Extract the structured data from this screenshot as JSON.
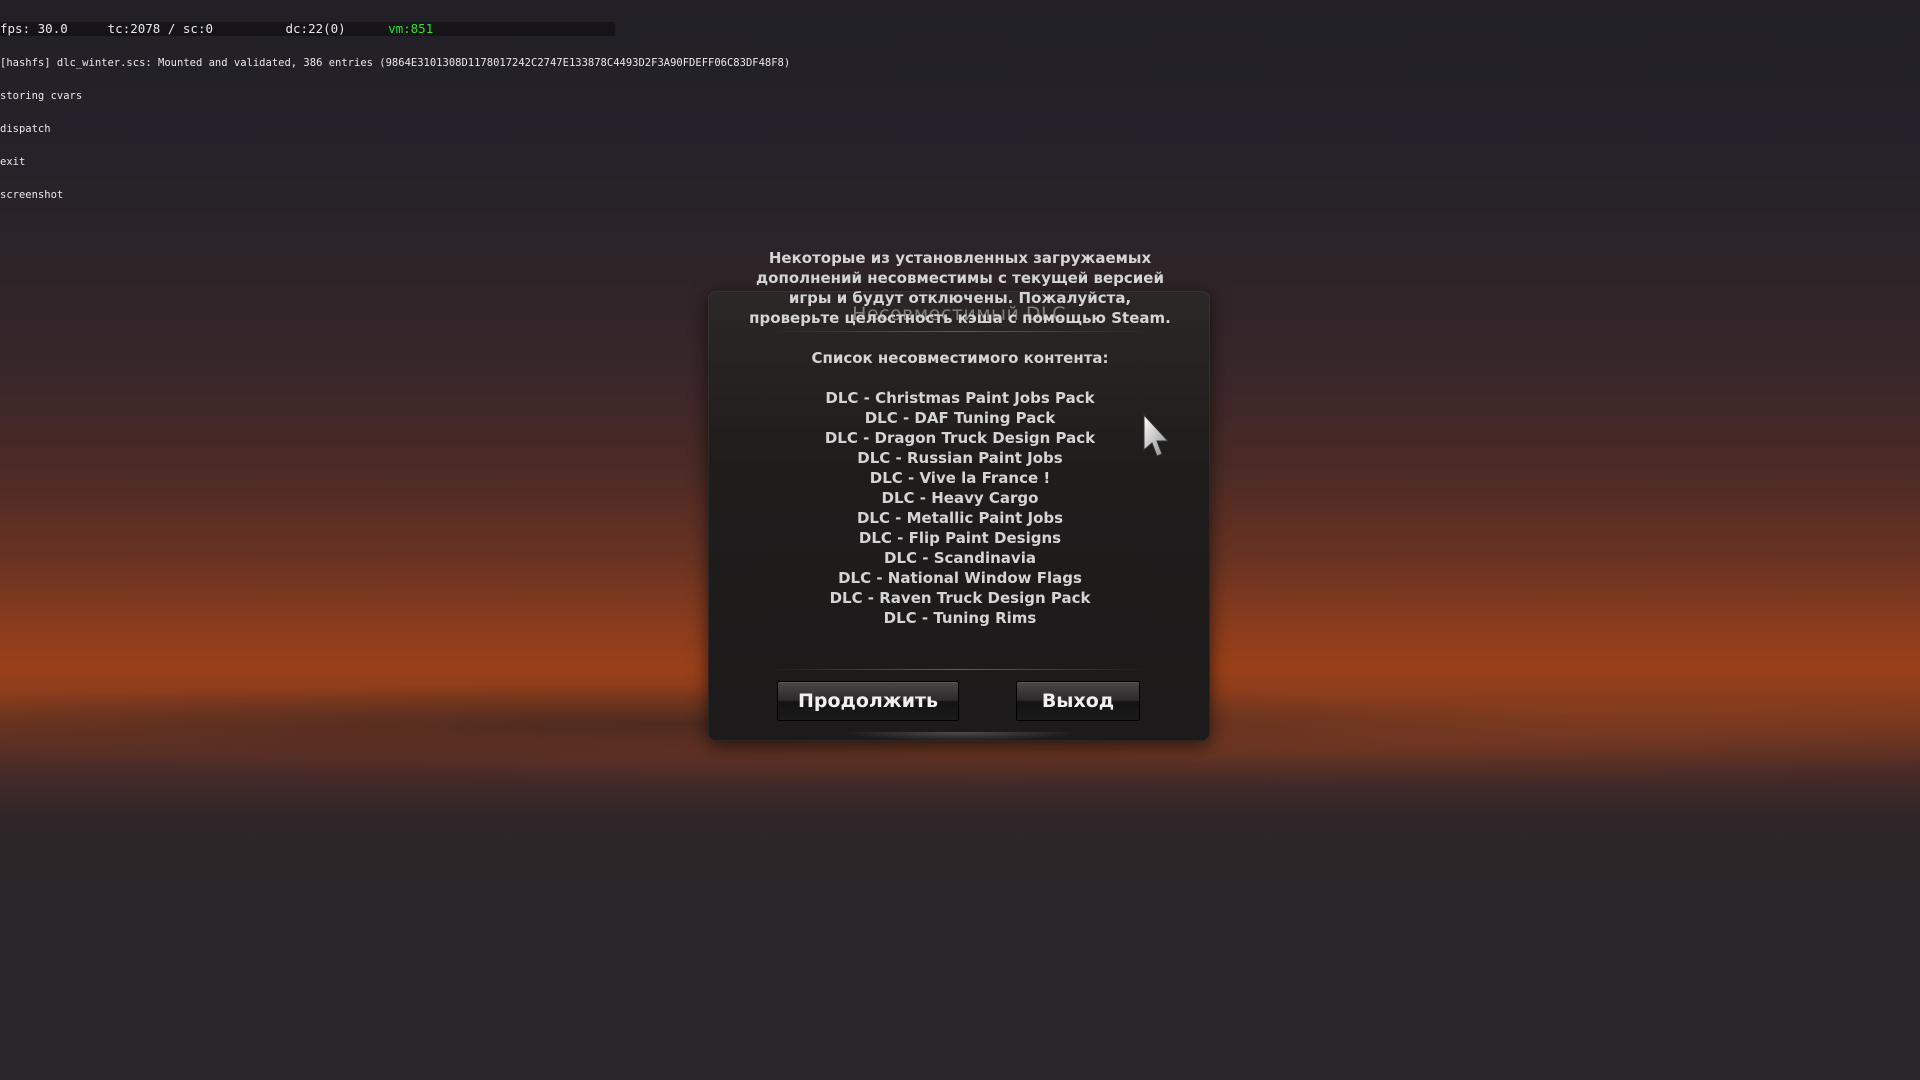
{
  "console": {
    "fps_label": "fps:",
    "fps_value": "30.0",
    "tc_label": "tc:",
    "tc_value": "2078",
    "sc_label": "/ sc:",
    "sc_value": "0",
    "dc_label": "dc:",
    "dc_value": "22(0)",
    "vm_label": "vm:",
    "vm_value": "851",
    "lines": [
      "[hashfs] dlc_winter.scs: Mounted and validated, 386 entries (9864E3101308D1178017242C2747E133878C4493D2F3A90FDEFF06C83DF48F8)",
      "storing cvars",
      "dispatch",
      "exit",
      "screenshot"
    ]
  },
  "dialog": {
    "title": "Несовместимый DLC",
    "message": "Некоторые из установленных загружаемых дополнений несовместимы с текущей версией игры и будут отключены. Пожалуйста, проверьте целостность кэша с помощью Steam.",
    "list_heading": "Список несовместимого контента:",
    "items": [
      "DLC - Christmas Paint Jobs Pack",
      "DLC - DAF Tuning Pack",
      "DLC - Dragon Truck Design Pack",
      "DLC - Russian Paint Jobs",
      "DLC - Vive la France !",
      "DLC - Heavy Cargo",
      "DLC - Metallic Paint Jobs",
      "DLC - Flip Paint Designs",
      "DLC - Scandinavia",
      "DLC - National Window Flags",
      "DLC - Raven Truck Design Pack",
      "DLC - Tuning Rims"
    ],
    "continue_label": "Продолжить",
    "exit_label": "Выход"
  },
  "colors": {
    "vm_text": "#2fe02f",
    "dialog_bg": "#1f1c1c",
    "sky_orange": "#9a4019"
  },
  "icons": {
    "cursor": "mouse-pointer-icon"
  }
}
